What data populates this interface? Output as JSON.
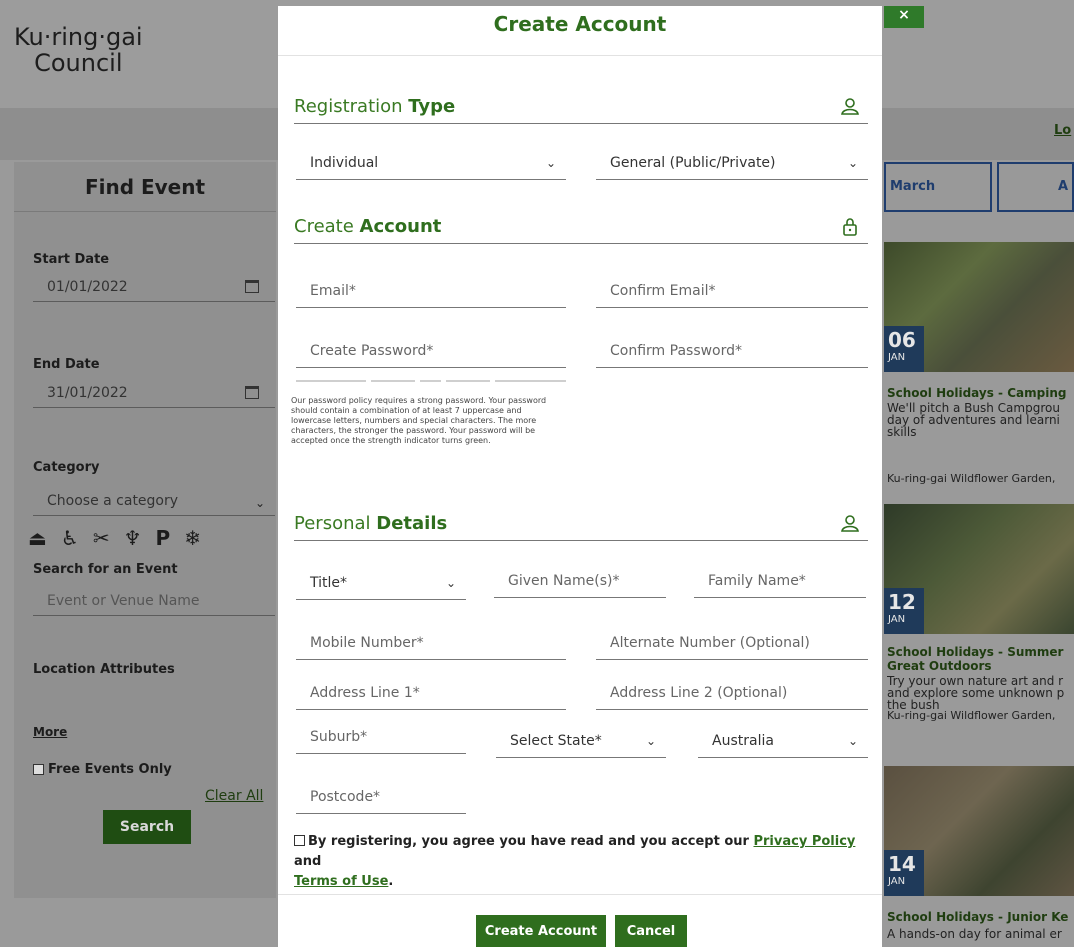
{
  "page": {
    "logo_line1": "Ku·ring·gai",
    "logo_line2": "Council",
    "login_link": "Lo",
    "close_label": "×"
  },
  "find_event": {
    "title": "Find Event",
    "start_date_label": "Start Date",
    "start_date_value": "01/01/2022",
    "end_date_label": "End Date",
    "end_date_value": "31/01/2022",
    "category_label": "Category",
    "category_value": "Choose a category",
    "search_label": "Search for an Event",
    "search_placeholder": "Event or Venue Name",
    "location_label": "Location Attributes",
    "location_icons": [
      "toilet-icon",
      "accessible-icon",
      "bbq-icon",
      "picnic-icon",
      "parking-icon",
      "air-conditioning-icon"
    ],
    "location_glyphs": [
      "⏏",
      "♿",
      "✂",
      "♆",
      "P",
      "❄"
    ],
    "more_link": "More",
    "free_only_label": "Free Events Only",
    "clear_all": "Clear All",
    "search_button": "Search"
  },
  "months": [
    "March",
    "A"
  ],
  "events": [
    {
      "day": "06",
      "month": "JAN",
      "title": "School Holidays - Camping",
      "desc": "We'll pitch a Bush Campgrou day of adventures and learni skills",
      "location": "Ku-ring-gai Wildflower Garden,"
    },
    {
      "day": "12",
      "month": "JAN",
      "title": "School Holidays - Summer",
      "title2": "Great Outdoors",
      "desc": "Try your own nature art and r and explore some unknown p the bush",
      "location": "Ku-ring-gai Wildflower Garden,"
    },
    {
      "day": "14",
      "month": "JAN",
      "title": "School Holidays - Junior Ke",
      "desc": "A hands-on day for animal er"
    }
  ],
  "modal": {
    "title": "Create Account",
    "registration": {
      "title_light": "Registration ",
      "title_bold": "Type",
      "type_value": "Individual",
      "category_value": "General (Public/Private)"
    },
    "account": {
      "title_light": "Create ",
      "title_bold": "Account",
      "email": "Email*",
      "confirm_email": "Confirm Email*",
      "password": "Create Password*",
      "confirm_password": "Confirm Password*",
      "policy": "Our password policy requires a strong password. Your password should contain a combination of at least 7 uppercase and lowercase letters, numbers and special characters. The more characters, the stronger the password. Your password will be accepted once the strength indicator turns green."
    },
    "personal": {
      "title_light": "Personal ",
      "title_bold": "Details",
      "title_field": "Title*",
      "given_name": "Given Name(s)*",
      "family_name": "Family Name*",
      "mobile": "Mobile Number*",
      "alternate": "Alternate Number (Optional)",
      "address1": "Address Line 1*",
      "address2": "Address Line 2 (Optional)",
      "suburb": "Suburb*",
      "state": "Select State*",
      "country": "Australia",
      "postcode": "Postcode*"
    },
    "agree_prefix": "By registering, you agree you have read and you accept our ",
    "privacy_link": "Privacy Policy",
    "agree_and": " and",
    "terms_link": "Terms of Use",
    "agree_suffix": ".",
    "create_button": "Create Account",
    "cancel_button": "Cancel"
  },
  "colors": {
    "brand_green": "#2f6e1e",
    "overlay_gray": "#9a9a9a",
    "badge_blue": "#1f3a5a"
  }
}
